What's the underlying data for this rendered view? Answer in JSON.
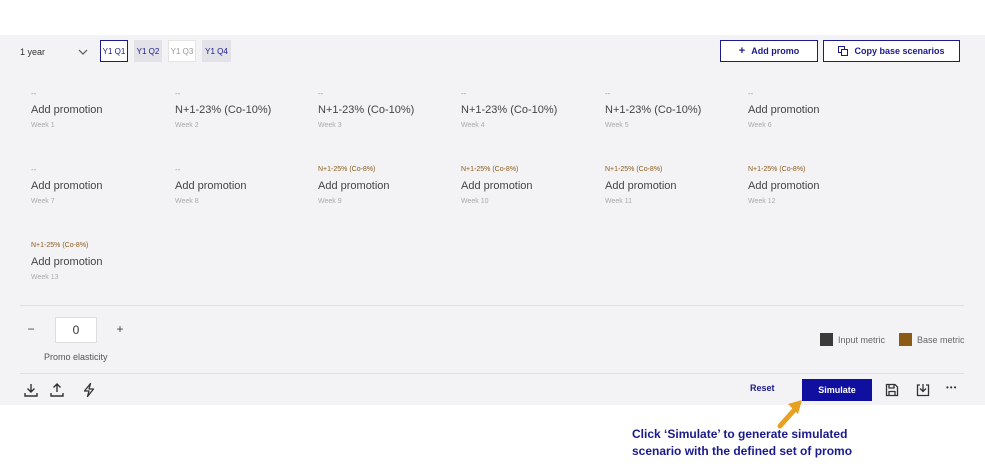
{
  "toolbar": {
    "period": "1 year",
    "quarter_tabs": [
      "Y1 Q1",
      "Y1 Q2",
      "Y1 Q3",
      "Y1 Q4"
    ],
    "add_promo_label": "Add promo",
    "copy_base_label": "Copy base scenarios"
  },
  "weeks": [
    {
      "tag": "--",
      "main": "Add promotion",
      "week": "Week 1"
    },
    {
      "tag": "--",
      "main": "N+1-23% (Co-10%)",
      "week": "Week 2"
    },
    {
      "tag": "--",
      "main": "N+1-23% (Co-10%)",
      "week": "Week 3"
    },
    {
      "tag": "--",
      "main": "N+1-23% (Co-10%)",
      "week": "Week 4"
    },
    {
      "tag": "--",
      "main": "N+1-23% (Co-10%)",
      "week": "Week 5"
    },
    {
      "tag": "--",
      "main": "Add promotion",
      "week": "Week 6"
    },
    {
      "tag": "--",
      "main": "Add promotion",
      "week": "Week 7"
    },
    {
      "tag": "--",
      "main": "Add promotion",
      "week": "Week 8"
    },
    {
      "tag": "N+1-25% (Co-8%)",
      "main": "Add promotion",
      "week": "Week 9"
    },
    {
      "tag": "N+1-25% (Co-8%)",
      "main": "Add promotion",
      "week": "Week 10"
    },
    {
      "tag": "N+1-25% (Co-8%)",
      "main": "Add promotion",
      "week": "Week 11"
    },
    {
      "tag": "N+1-25% (Co-8%)",
      "main": "Add promotion",
      "week": "Week 12"
    },
    {
      "tag": "N+1-25% (Co-8%)",
      "main": "Add promotion",
      "week": "Week 13"
    }
  ],
  "elasticity": {
    "minus": "−",
    "value": "0",
    "plus": "+",
    "label": "Promo elasticity"
  },
  "legend": {
    "input_label": "Input metric",
    "input_color": "#3a3a3a",
    "base_label": "Base metric",
    "base_color": "#8b5a14"
  },
  "footer": {
    "reset_label": "Reset",
    "simulate_label": "Simulate",
    "more_label": "•••"
  },
  "annotation": {
    "line1": "Click ‘Simulate’ to generate simulated",
    "line2": "scenario with the defined set of promo"
  }
}
